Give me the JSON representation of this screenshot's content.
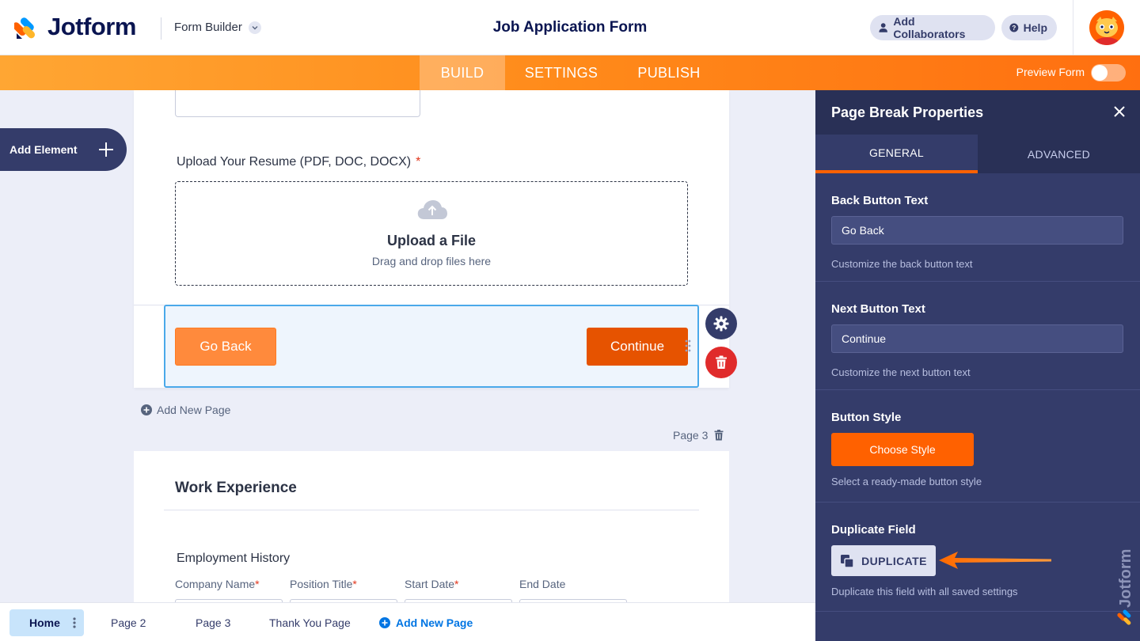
{
  "header": {
    "logo_text": "Jotform",
    "builder_label": "Form Builder",
    "form_title": "Job Application Form",
    "add_collaborators": "Add Collaborators",
    "help": "Help"
  },
  "nav": {
    "tabs": [
      "BUILD",
      "SETTINGS",
      "PUBLISH"
    ],
    "active_tab": "BUILD",
    "preview_label": "Preview Form",
    "preview_on": false
  },
  "sidebar": {
    "add_element": "Add Element"
  },
  "form": {
    "upload_label": "Upload Your Resume (PDF, DOC, DOCX)",
    "required_mark": "*",
    "upload_title": "Upload a File",
    "upload_subtitle": "Drag and drop files here",
    "back_button": "Go Back",
    "continue_button": "Continue",
    "add_new_page": "Add New Page",
    "page_label": "Page 3",
    "section_heading": "Work Experience",
    "employment_label": "Employment History",
    "columns": [
      {
        "label": "Company Name",
        "required": true
      },
      {
        "label": "Position Title",
        "required": true
      },
      {
        "label": "Start Date",
        "required": true
      },
      {
        "label": "End Date",
        "required": false
      }
    ]
  },
  "pagebar": {
    "home": "Home",
    "pages": [
      "Page 2",
      "Page 3",
      "Thank You Page"
    ],
    "add_new": "Add New Page"
  },
  "panel": {
    "title": "Page Break Properties",
    "tabs": [
      "GENERAL",
      "ADVANCED"
    ],
    "active_tab": "GENERAL",
    "back_button_title": "Back Button Text",
    "back_button_value": "Go Back",
    "back_button_help": "Customize the back button text",
    "next_button_title": "Next Button Text",
    "next_button_value": "Continue",
    "next_button_help": "Customize the next button text",
    "button_style_title": "Button Style",
    "choose_style": "Choose Style",
    "button_style_help": "Select a ready-made button style",
    "duplicate_title": "Duplicate Field",
    "duplicate_button": "DUPLICATE",
    "duplicate_help": "Duplicate this field with all saved settings"
  },
  "colors": {
    "brand_orange": "#ff6100",
    "navy": "#0a1551",
    "panel_bg": "#343c6a",
    "delete_red": "#e02b2b",
    "link_blue": "#0075e3"
  }
}
